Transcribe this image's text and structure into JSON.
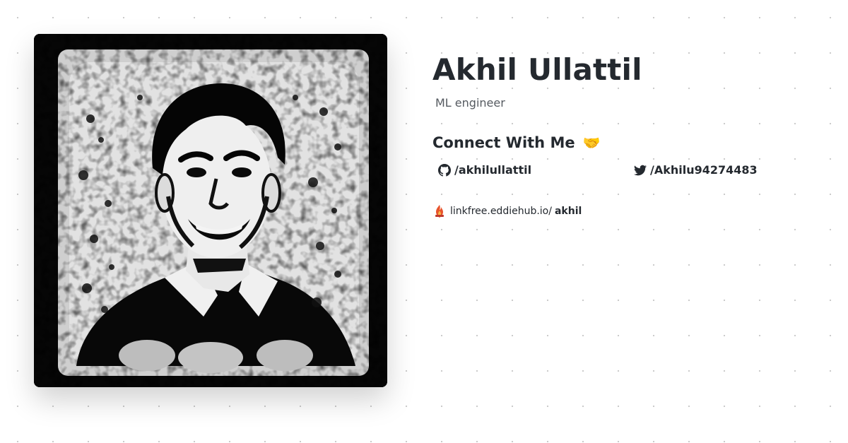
{
  "profile": {
    "name": "Akhil Ullattil",
    "bio": "ML engineer"
  },
  "connect": {
    "heading": "Connect With Me",
    "emoji": "🤝"
  },
  "socials": [
    {
      "label": "/akhilullattil",
      "icon": "github-icon"
    },
    {
      "label": "/Akhilu94274483",
      "icon": "twitter-icon"
    }
  ],
  "footer": {
    "domain": "linkfree.eddiehub.io/",
    "username": "akhil",
    "icon": "linkfree-logo-icon"
  },
  "colors": {
    "text": "#24292f",
    "muted": "#555a60",
    "dot_grid": "#c9c9c9"
  }
}
